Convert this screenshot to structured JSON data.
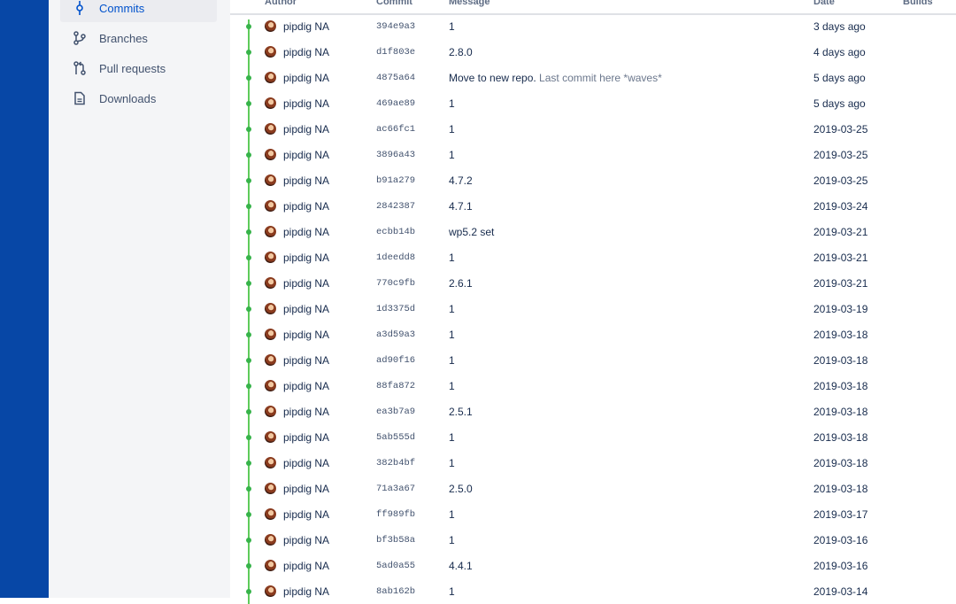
{
  "sidebar": {
    "items": [
      {
        "label": "Commits",
        "icon": "commit-icon",
        "active": true
      },
      {
        "label": "Branches",
        "icon": "branch-icon",
        "active": false
      },
      {
        "label": "Pull requests",
        "icon": "pull-request-icon",
        "active": false
      },
      {
        "label": "Downloads",
        "icon": "document-icon",
        "active": false
      }
    ]
  },
  "table": {
    "headers": {
      "author": "Author",
      "commit": "Commit",
      "message": "Message",
      "date": "Date",
      "builds": "Builds"
    },
    "rows": [
      {
        "author": "pipdig NA",
        "hash": "394e9a3",
        "message": "1",
        "message_extra": "",
        "date": "3 days ago"
      },
      {
        "author": "pipdig NA",
        "hash": "d1f803e",
        "message": "2.8.0",
        "message_extra": "",
        "date": "4 days ago"
      },
      {
        "author": "pipdig NA",
        "hash": "4875a64",
        "message": "Move to new repo.",
        "message_extra": "Last commit here *waves*",
        "date": "5 days ago"
      },
      {
        "author": "pipdig NA",
        "hash": "469ae89",
        "message": "1",
        "message_extra": "",
        "date": "5 days ago"
      },
      {
        "author": "pipdig NA",
        "hash": "ac66fc1",
        "message": "1",
        "message_extra": "",
        "date": "2019-03-25"
      },
      {
        "author": "pipdig NA",
        "hash": "3896a43",
        "message": "1",
        "message_extra": "",
        "date": "2019-03-25"
      },
      {
        "author": "pipdig NA",
        "hash": "b91a279",
        "message": "4.7.2",
        "message_extra": "",
        "date": "2019-03-25"
      },
      {
        "author": "pipdig NA",
        "hash": "2842387",
        "message": "4.7.1",
        "message_extra": "",
        "date": "2019-03-24"
      },
      {
        "author": "pipdig NA",
        "hash": "ecbb14b",
        "message": "wp5.2 set",
        "message_extra": "",
        "date": "2019-03-21"
      },
      {
        "author": "pipdig NA",
        "hash": "1deedd8",
        "message": "1",
        "message_extra": "",
        "date": "2019-03-21"
      },
      {
        "author": "pipdig NA",
        "hash": "770c9fb",
        "message": "2.6.1",
        "message_extra": "",
        "date": "2019-03-21"
      },
      {
        "author": "pipdig NA",
        "hash": "1d3375d",
        "message": "1",
        "message_extra": "",
        "date": "2019-03-19"
      },
      {
        "author": "pipdig NA",
        "hash": "a3d59a3",
        "message": "1",
        "message_extra": "",
        "date": "2019-03-18"
      },
      {
        "author": "pipdig NA",
        "hash": "ad90f16",
        "message": "1",
        "message_extra": "",
        "date": "2019-03-18"
      },
      {
        "author": "pipdig NA",
        "hash": "88fa872",
        "message": "1",
        "message_extra": "",
        "date": "2019-03-18"
      },
      {
        "author": "pipdig NA",
        "hash": "ea3b7a9",
        "message": "2.5.1",
        "message_extra": "",
        "date": "2019-03-18"
      },
      {
        "author": "pipdig NA",
        "hash": "5ab555d",
        "message": "1",
        "message_extra": "",
        "date": "2019-03-18"
      },
      {
        "author": "pipdig NA",
        "hash": "382b4bf",
        "message": "1",
        "message_extra": "",
        "date": "2019-03-18"
      },
      {
        "author": "pipdig NA",
        "hash": "71a3a67",
        "message": "2.5.0",
        "message_extra": "",
        "date": "2019-03-18"
      },
      {
        "author": "pipdig NA",
        "hash": "ff989fb",
        "message": "1",
        "message_extra": "",
        "date": "2019-03-17"
      },
      {
        "author": "pipdig NA",
        "hash": "bf3b58a",
        "message": "1",
        "message_extra": "",
        "date": "2019-03-16"
      },
      {
        "author": "pipdig NA",
        "hash": "5ad0a55",
        "message": "4.4.1",
        "message_extra": "",
        "date": "2019-03-16"
      },
      {
        "author": "pipdig NA",
        "hash": "8ab162b",
        "message": "1",
        "message_extra": "",
        "date": "2019-03-14"
      }
    ]
  },
  "colors": {
    "global_nav": "#0747a6",
    "graph": "#5ecb5a",
    "active_link": "#0052cc"
  }
}
